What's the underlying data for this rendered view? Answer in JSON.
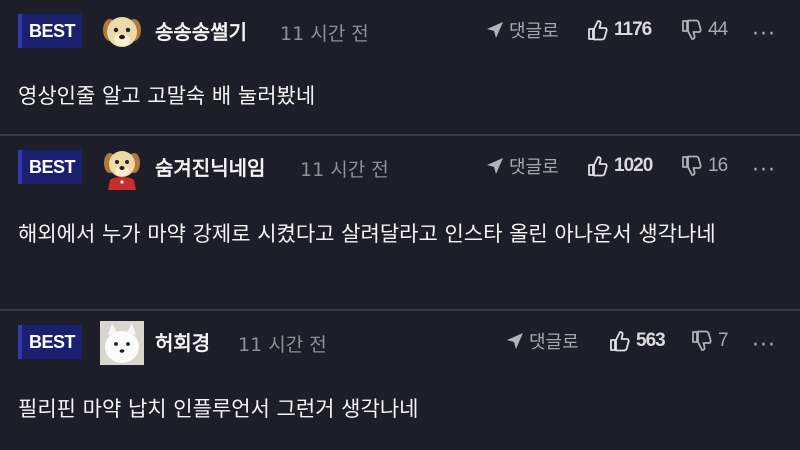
{
  "comments": [
    {
      "badge": "BEST",
      "author": "송송송썰기",
      "time": "11 시간 전",
      "reply_label": "댓글로",
      "upvotes": "1176",
      "downvotes": "44",
      "more": "···",
      "avatar_icon": "puppy-avatar-icon",
      "text": "영상인줄 알고 고말숙 배 눌러봤네"
    },
    {
      "badge": "BEST",
      "author": "숨겨진닉네임",
      "time": "11 시간 전",
      "reply_label": "댓글로",
      "upvotes": "1020",
      "downvotes": "16",
      "more": "···",
      "avatar_icon": "puppy-red-shirt-avatar-icon",
      "text": "해외에서 누가 마약 강제로 시켰다고 살려달라고 인스타 올린 아나운서 생각나네"
    },
    {
      "badge": "BEST",
      "author": "허회경",
      "time": "11 시간 전",
      "reply_label": "댓글로",
      "upvotes": "563",
      "downvotes": "7",
      "more": "···",
      "avatar_icon": "white-dog-avatar-icon",
      "text": "필리핀 마약 납치 인플루언서 그런거 생각나네"
    }
  ],
  "colors": {
    "background": "#1e1e2a",
    "badge": "#1a1f6e",
    "divider": "#3b3b47",
    "muted_text": "#8f8f99"
  }
}
